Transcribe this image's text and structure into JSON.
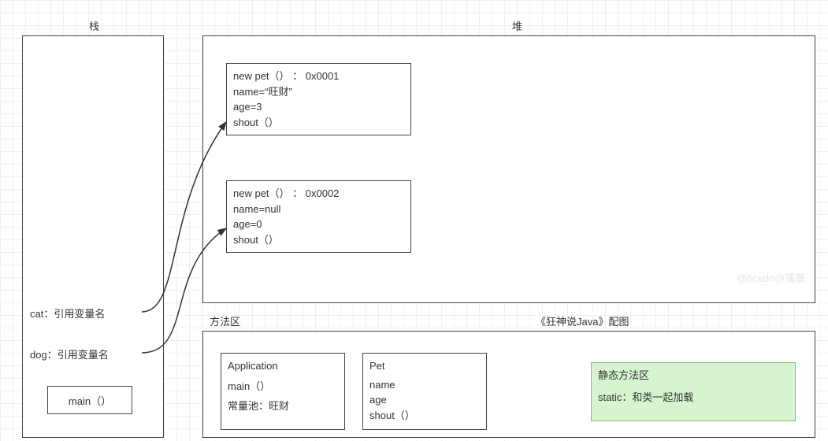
{
  "titles": {
    "stack": "栈",
    "heap": "堆",
    "method_area": "方法区",
    "book_caption": "《狂神说Java》配图"
  },
  "stack": {
    "cat_label": "cat：引用变量名",
    "dog_label": "dog：引用变量名",
    "main_frame": "main（）"
  },
  "heap": {
    "pet1": {
      "line1": "new pet（） ： 0x0001",
      "line2": "name=“旺财”",
      "line3": "age=3",
      "line4": "shout（）"
    },
    "pet2": {
      "line1": "new pet（） ： 0x0002",
      "line2": "name=null",
      "line3": "age=0",
      "line4": "shout（）"
    }
  },
  "method_area": {
    "application": {
      "title": "Application",
      "main": "main（）",
      "const_pool": "常量池：旺财"
    },
    "pet_class": {
      "title": "Pet",
      "f1": "name",
      "f2": "age",
      "f3": "shout（）"
    },
    "static_area": {
      "title": "静态方法区",
      "note": "static：和类一起加载"
    }
  },
  "watermark": "@5csdn@蒲寰"
}
